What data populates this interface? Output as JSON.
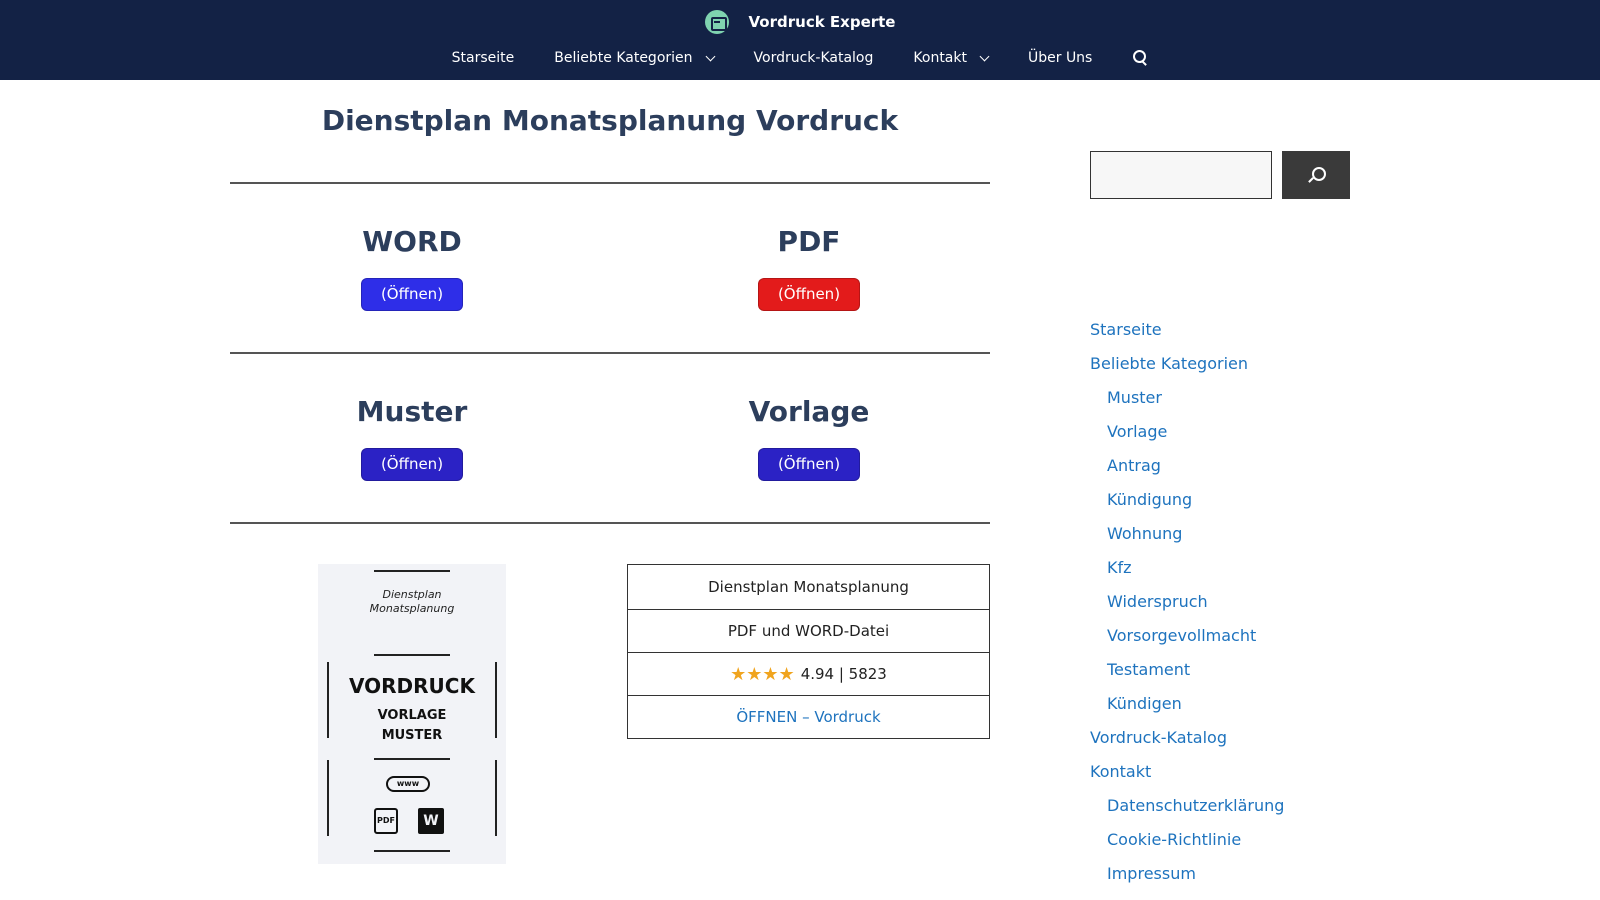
{
  "header": {
    "site_title": "Vordruck Experte",
    "nav": [
      {
        "label": "Starseite",
        "has_dropdown": false
      },
      {
        "label": "Beliebte Kategorien",
        "has_dropdown": true
      },
      {
        "label": "Vordruck-Katalog",
        "has_dropdown": false
      },
      {
        "label": "Kontakt",
        "has_dropdown": true
      },
      {
        "label": "Über Uns",
        "has_dropdown": false
      }
    ],
    "search_icon": "search-icon",
    "colors": {
      "background": "#132245",
      "logo": "#7fd3b0"
    }
  },
  "main": {
    "title": "Dienstplan Monatsplanung Vordruck",
    "formats": [
      {
        "title": "WORD",
        "button": "(Öffnen)",
        "color": "#2e2ee8"
      },
      {
        "title": "PDF",
        "button": "(Öffnen)",
        "color": "#e31b1b"
      },
      {
        "title": "Muster",
        "button": "(Öffnen)",
        "color": "#2b22c5"
      },
      {
        "title": "Vorlage",
        "button": "(Öffnen)",
        "color": "#2b22c5"
      }
    ],
    "preview": {
      "subtitle_line1": "Dienstplan",
      "subtitle_line2": "Monatsplanung",
      "heading": "VORDRUCK",
      "line1": "VORLAGE",
      "line2": "MUSTER",
      "www_label": "www",
      "pdf_label": "PDF",
      "word_label": "W"
    },
    "info_table": {
      "name": "Dienstplan Monatsplanung",
      "file_types": "PDF und WORD-Datei",
      "stars": "★★★★",
      "rating": "4.94 | 5823",
      "link": "ÖFFNEN – Vordruck"
    }
  },
  "sidebar": {
    "search_placeholder": "",
    "menu": [
      {
        "label": "Starseite",
        "level": 0
      },
      {
        "label": "Beliebte Kategorien",
        "level": 0
      },
      {
        "label": "Muster",
        "level": 1
      },
      {
        "label": "Vorlage",
        "level": 1
      },
      {
        "label": "Antrag",
        "level": 1
      },
      {
        "label": "Kündigung",
        "level": 1
      },
      {
        "label": "Wohnung",
        "level": 1
      },
      {
        "label": "Kfz",
        "level": 1
      },
      {
        "label": "Widerspruch",
        "level": 1
      },
      {
        "label": "Vorsorgevollmacht",
        "level": 1
      },
      {
        "label": "Testament",
        "level": 1
      },
      {
        "label": "Kündigen",
        "level": 1
      },
      {
        "label": "Vordruck-Katalog",
        "level": 0
      },
      {
        "label": "Kontakt",
        "level": 0
      },
      {
        "label": "Datenschutzerklärung",
        "level": 1
      },
      {
        "label": "Cookie-Richtlinie",
        "level": 1
      },
      {
        "label": "Impressum",
        "level": 1
      }
    ],
    "link_color": "#1e73be"
  }
}
